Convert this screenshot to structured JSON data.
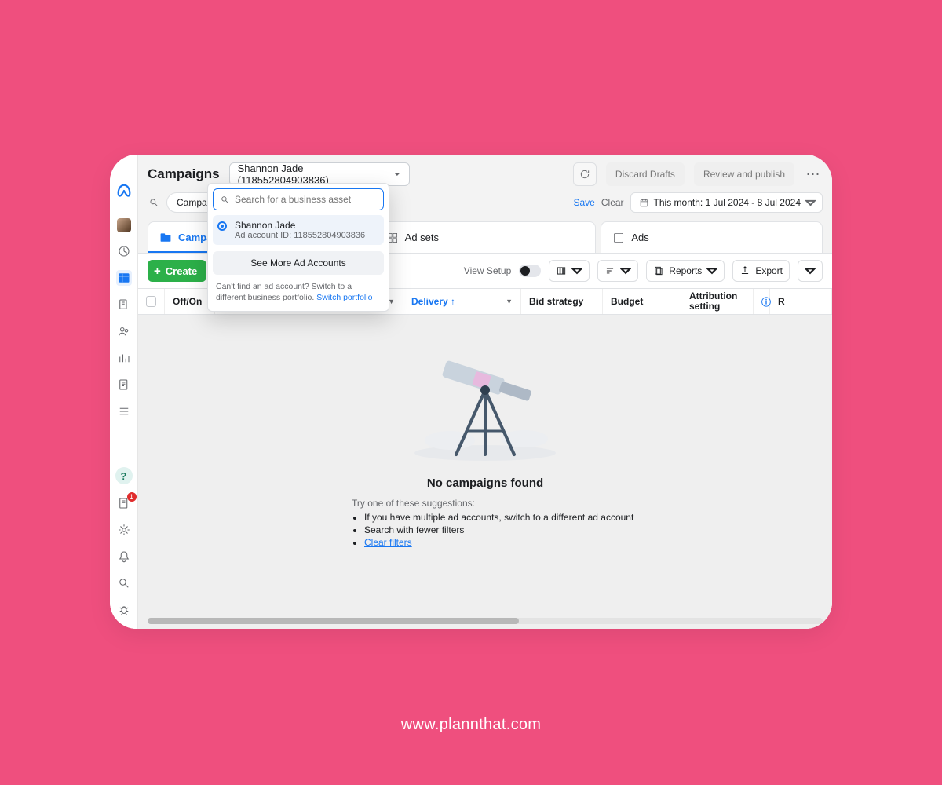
{
  "caption": "www.plannthat.com",
  "page_title": "Campaigns",
  "account_selector": {
    "selected": "Shannon Jade (118552804903836)",
    "search_placeholder": "Search for a business asset",
    "option": {
      "name": "Shannon Jade",
      "id_label": "Ad account ID: 118552804903836"
    },
    "see_more": "See More Ad Accounts",
    "cannot_find": "Can't find an ad account? Switch to a different business portfolio.",
    "switch_link": "Switch portfolio"
  },
  "topbar": {
    "discard": "Discard Drafts",
    "review": "Review and publish"
  },
  "filterbar": {
    "pill": "Campaign N",
    "save": "Save",
    "clear": "Clear",
    "date_label": "This month: 1 Jul 2024 - 8 Jul 2024"
  },
  "tabs": {
    "campaigns": "Campaigns",
    "adsets": "Ad sets",
    "ads": "Ads"
  },
  "toolbar": {
    "create": "Create",
    "view_setup": "View Setup",
    "reports": "Reports",
    "export": "Export"
  },
  "table": {
    "off_on": "Off/On",
    "delivery": "Delivery",
    "bid": "Bid strategy",
    "budget": "Budget",
    "attribution": "Attribution setting",
    "results_initial": "R"
  },
  "empty": {
    "title": "No campaigns found",
    "try": "Try one of these suggestions:",
    "s1": "If you have multiple ad accounts, switch to a different ad account",
    "s2": "Search with fewer filters",
    "s3": "Clear filters"
  },
  "badge_count": "1"
}
